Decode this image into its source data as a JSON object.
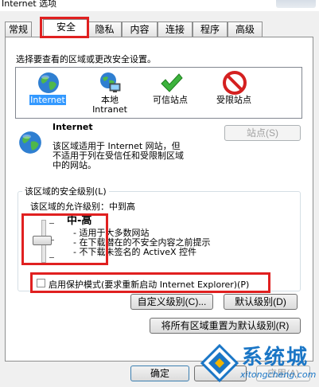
{
  "window": {
    "title": "Internet 选项"
  },
  "tabs": [
    "常规",
    "安全",
    "隐私",
    "内容",
    "连接",
    "程序",
    "高级"
  ],
  "active_tab": "安全",
  "zones": {
    "instruction": "选择要查看的区域或更改安全设置。",
    "items": [
      {
        "label_line1": "Internet",
        "label_line2": "",
        "icon": "globe-icon"
      },
      {
        "label_line1": "本地",
        "label_line2": "Intranet",
        "icon": "intranet-icon"
      },
      {
        "label_line1": "可信站点",
        "label_line2": "",
        "icon": "checkmark-icon"
      },
      {
        "label_line1": "受限站点",
        "label_line2": "",
        "icon": "no-entry-icon"
      }
    ],
    "selected": "Internet"
  },
  "zone_info": {
    "title": "Internet",
    "description_lines": [
      "该区域适用于 Internet 网站，但",
      "不适用于列在受信任和受限制区域",
      "中的网站。"
    ],
    "sites_button": "站点(S)"
  },
  "security_level": {
    "group_title": "该区域的安全级别(L)",
    "allowed_levels": "该区域的允许级别：中到高",
    "level_name": "中-高",
    "bullets": [
      "- 适用于大多数网站",
      "- 在下载潜在的不安全内容之前提示",
      "- 不下载未签名的 ActiveX 控件"
    ],
    "slider_level": "中-高"
  },
  "protected_mode": {
    "label": "启用保护模式(要求重新启动 Internet Explorer)(P)",
    "checked": false
  },
  "buttons": {
    "custom_level": "自定义级别(C)...",
    "default_level": "默认级别(D)",
    "reset_all": "将所有区域重置为默认级别(R)",
    "ok": "确定",
    "cancel": "",
    "apply": "应用(A)"
  },
  "watermark": {
    "brand": "系统城",
    "url": "xitongcheng.com"
  },
  "colors": {
    "highlight": "#e02020",
    "selection": "#3399ff",
    "brand": "#1a76c6"
  }
}
